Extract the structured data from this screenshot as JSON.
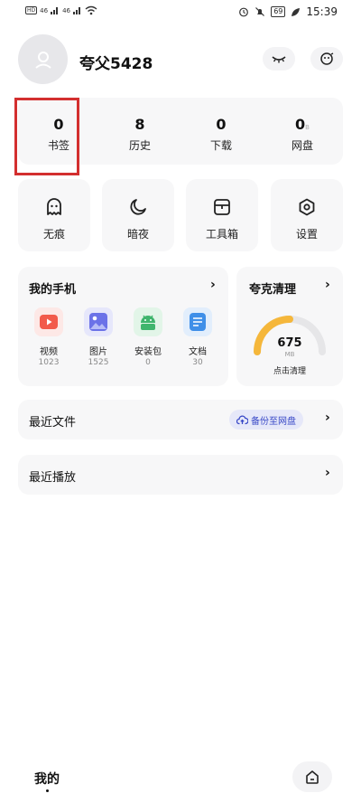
{
  "status_bar": {
    "left_items": [
      "HD",
      "46",
      "46"
    ],
    "battery": "69",
    "time": "15:39"
  },
  "profile": {
    "username": "夸父5428"
  },
  "stats": [
    {
      "value": "0",
      "label": "书签"
    },
    {
      "value": "8",
      "label": "历史"
    },
    {
      "value": "0",
      "label": "下载"
    },
    {
      "value": "0",
      "unit": "B",
      "label": "网盘"
    }
  ],
  "tools": [
    {
      "icon": "ghost-icon",
      "label": "无痕"
    },
    {
      "icon": "moon-icon",
      "label": "暗夜"
    },
    {
      "icon": "toolbox-icon",
      "label": "工具箱"
    },
    {
      "icon": "gear-icon",
      "label": "设置"
    }
  ],
  "my_phone": {
    "title": "我的手机",
    "apps": [
      {
        "icon": "video-icon",
        "name": "视频",
        "count": "1023",
        "color": "#f25a4b"
      },
      {
        "icon": "image-icon",
        "name": "图片",
        "count": "1525",
        "color": "#6b72e8"
      },
      {
        "icon": "android-icon",
        "name": "安装包",
        "count": "0",
        "color": "#3fb56d"
      },
      {
        "icon": "document-icon",
        "name": "文档",
        "count": "30",
        "color": "#3f8fe8"
      }
    ]
  },
  "cleaner": {
    "title": "夸克清理",
    "value": "675",
    "unit": "MB",
    "action": "点击清理",
    "gauge_fill": 0.5,
    "gauge_color": "#f5b73b"
  },
  "recent_files": {
    "title": "最近文件",
    "backup_label": "备份至网盘"
  },
  "recent_play": {
    "title": "最近播放"
  },
  "bottom_nav": {
    "title": "我的"
  },
  "highlight_color": "#d32f2f"
}
